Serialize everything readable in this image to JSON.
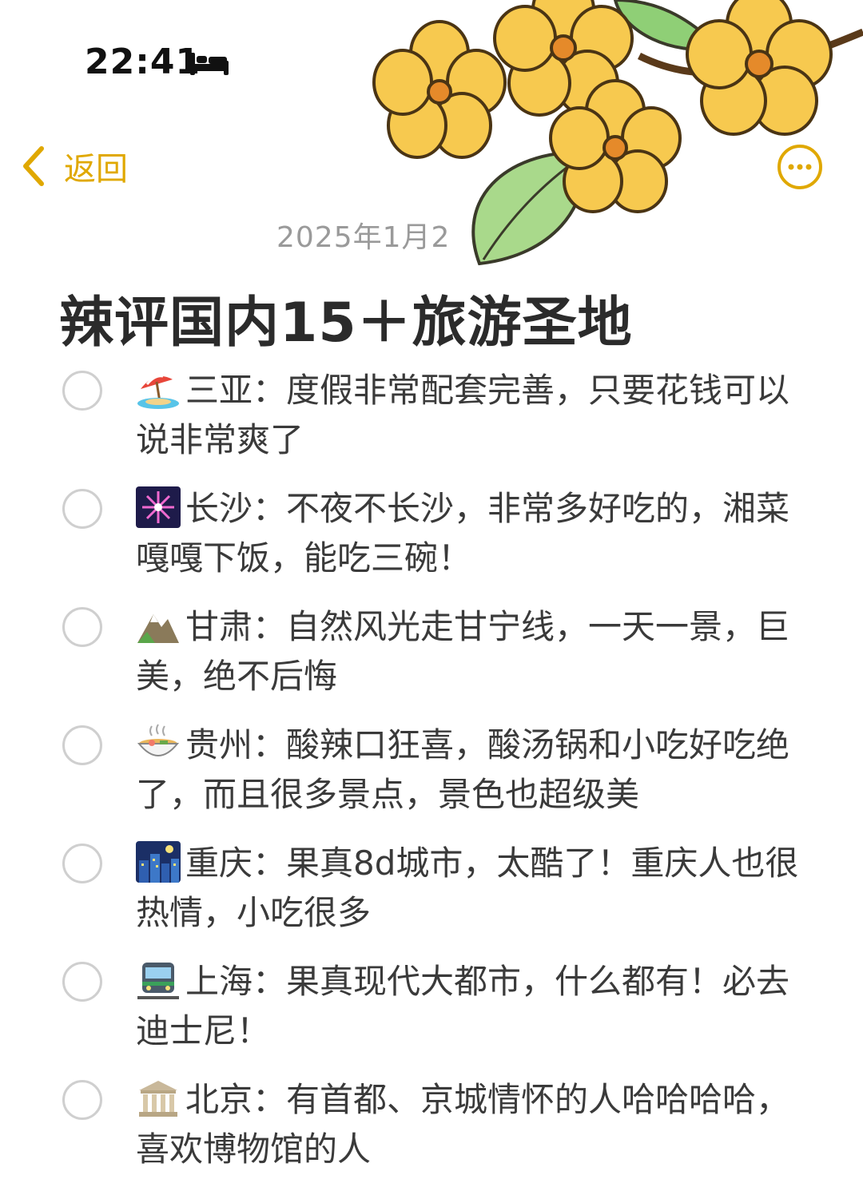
{
  "status_bar": {
    "time": "22:41",
    "focus_icon": "bed-icon"
  },
  "nav": {
    "back_label": "返回",
    "back_icon": "chevron-left-icon",
    "more_icon": "ellipsis-circle-icon"
  },
  "note": {
    "date": "2025年1月2",
    "title": "辣评国内15＋旅游圣地",
    "items": [
      {
        "icon": "beach-umbrella-icon",
        "text": "三亚：度假非常配套完善，只要花钱可以说非常爽了",
        "checked": false
      },
      {
        "icon": "fireworks-icon",
        "text": "长沙：不夜不长沙，非常多好吃的，湘菜嘎嘎下饭，能吃三碗！",
        "checked": false
      },
      {
        "icon": "mountain-icon",
        "text": "甘肃：自然风光走甘宁线，一天一景，巨美，绝不后悔",
        "checked": false
      },
      {
        "icon": "noodle-bowl-icon",
        "text": "贵州：酸辣口狂喜，酸汤锅和小吃好吃绝了，而且很多景点，景色也超级美",
        "checked": false
      },
      {
        "icon": "night-city-icon",
        "text": "重庆：果真8d城市，太酷了！重庆人也很热情，小吃很多",
        "checked": false
      },
      {
        "icon": "train-icon",
        "text": "上海：果真现代大都市，什么都有！必去迪士尼！",
        "checked": false
      },
      {
        "icon": "classical-building-icon",
        "text": "北京：有首都、京城情怀的人哈哈哈哈，喜欢博物馆的人",
        "checked": false
      }
    ]
  },
  "colors": {
    "accent": "#e0a800",
    "title": "#2b2b2b",
    "date": "#9a9a9a",
    "circle": "#cfcfcf"
  }
}
